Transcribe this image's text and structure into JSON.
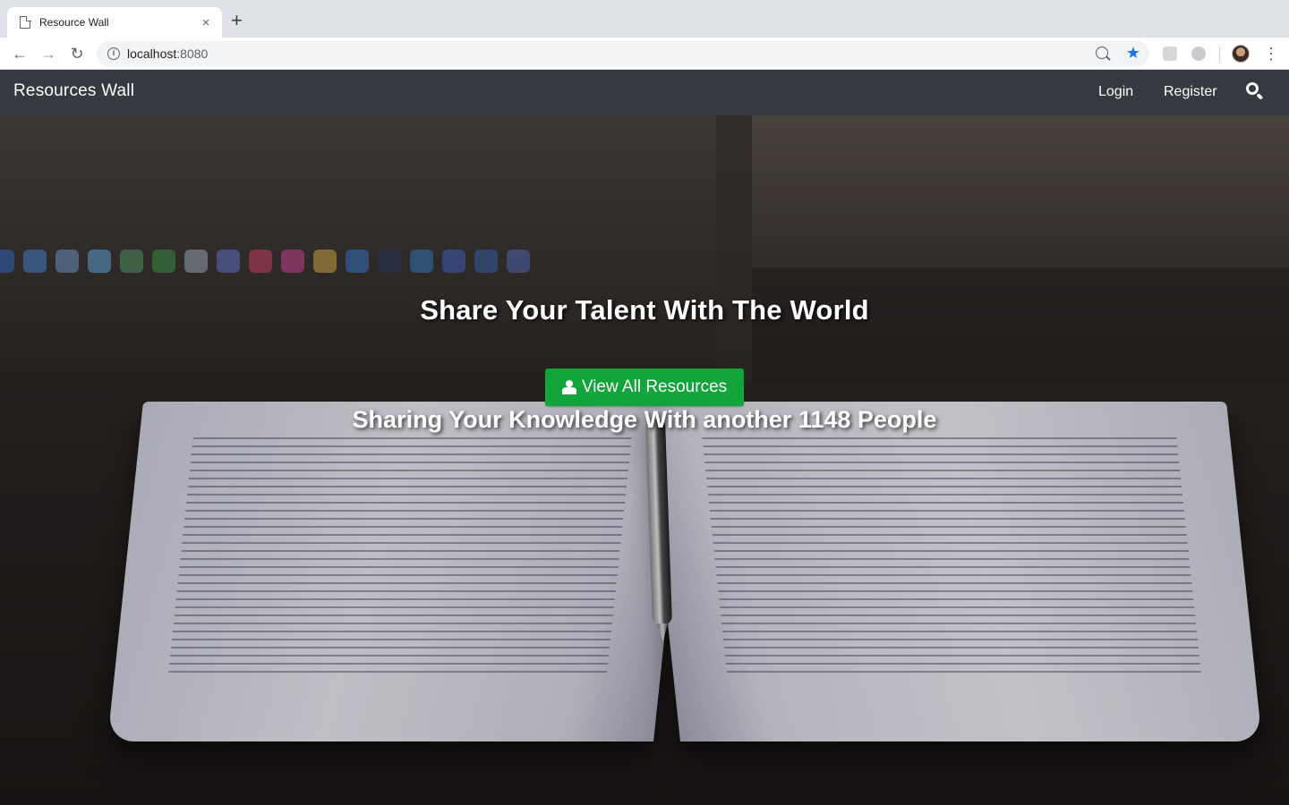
{
  "browser": {
    "tab_title": "Resource Wall",
    "new_tab_symbol": "+",
    "close_symbol": "×",
    "url_host": "localhost",
    "url_port": ":8080",
    "icons": [
      "document-icon",
      "close-icon",
      "back-arrow-icon",
      "forward-arrow-icon",
      "reload-icon",
      "info-icon",
      "zoom-icon",
      "star-icon",
      "extension-icon",
      "profile-avatar",
      "menu-dots-icon"
    ],
    "star_color": "#1a73e8"
  },
  "navbar": {
    "brand": "Resources Wall",
    "links": [
      "Login",
      "Register"
    ],
    "search_icon": "search-icon",
    "background": "#343a40"
  },
  "hero": {
    "title": "Share Your Talent With The World",
    "cta_label": "View All Resources",
    "cta_icon": "user-icon",
    "cta_color": "#12a53c",
    "subtitle": "Sharing Your Knowledge With another 1148 People"
  }
}
